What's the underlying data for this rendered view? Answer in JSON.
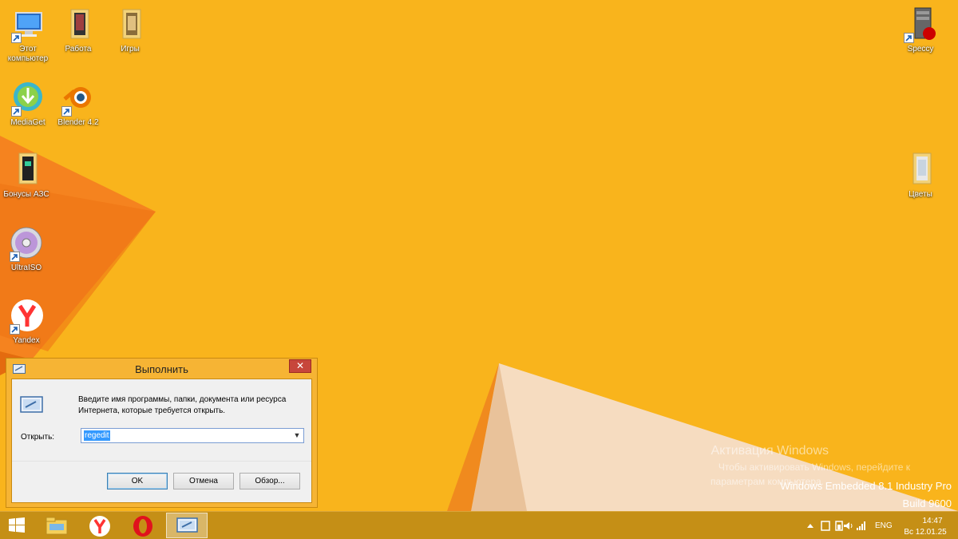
{
  "desktop": {
    "icons": [
      {
        "label": "Этот компьютер",
        "icon": "computer-icon"
      },
      {
        "label": "Работа",
        "icon": "folder-icon"
      },
      {
        "label": "Игры",
        "icon": "folder-icon"
      },
      {
        "label": "MediaGet",
        "icon": "mediaget-icon"
      },
      {
        "label": "Blender 4.2",
        "icon": "blender-icon"
      },
      {
        "label": "Бонусы АЗС",
        "icon": "folder-icon"
      },
      {
        "label": "UltraISO",
        "icon": "disc-icon"
      },
      {
        "label": "Yandex",
        "icon": "yandex-icon"
      },
      {
        "label": "Speccy",
        "icon": "speccy-icon"
      },
      {
        "label": "Цветы",
        "icon": "folder-icon"
      }
    ]
  },
  "watermark": {
    "title": "Активация Windows",
    "line1": "Чтобы активировать Windows, перейдите к",
    "line2": "параметрам компьютера.",
    "edition": "Windows Embedded 8.1 Industry Pro",
    "build": "Build 9600"
  },
  "run_dialog": {
    "title": "Выполнить",
    "close_label": "✕",
    "description": "Введите имя программы, папки, документа или ресурса Интернета, которые требуется открыть.",
    "open_label": "Открыть:",
    "open_value": "regedit",
    "ok_label": "OK",
    "cancel_label": "Отмена",
    "browse_label": "Обзор..."
  },
  "taskbar": {
    "buttons": [
      "start-icon",
      "file-explorer-icon",
      "yandex-browser-icon",
      "opera-icon",
      "run-icon"
    ],
    "tray": {
      "language": "ENG",
      "time": "14:47",
      "date": "Вс 12.01.25"
    }
  },
  "colors": {
    "desktop": "#f9b41c",
    "taskbar": "#c58f16",
    "dialog_frame": "#f6b434"
  }
}
